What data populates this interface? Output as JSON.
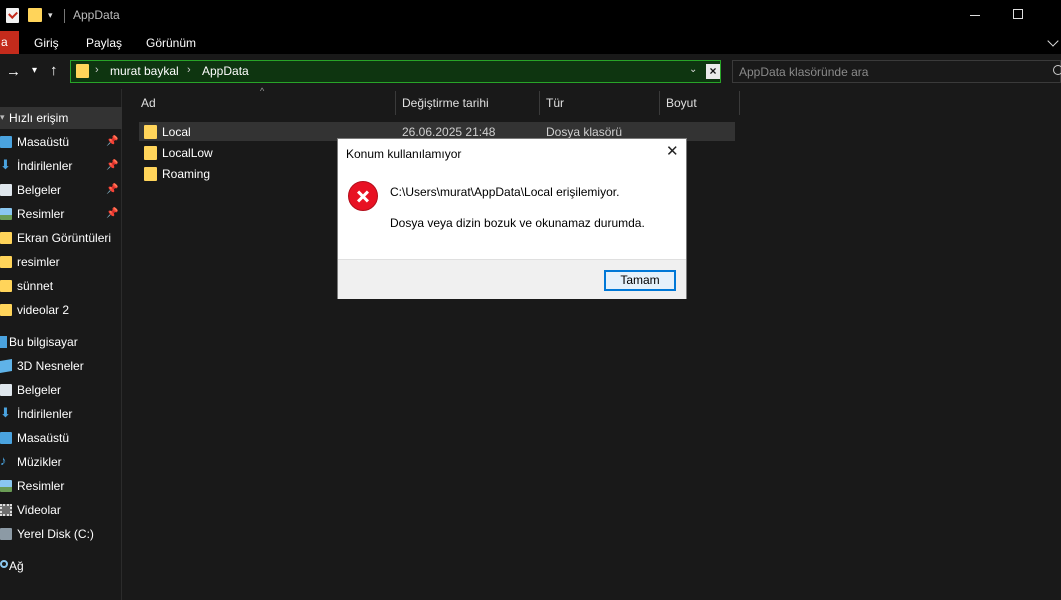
{
  "window": {
    "title": "AppData"
  },
  "ribbon": {
    "file_label": "a",
    "tabs": [
      "Giriş",
      "Paylaş",
      "Görünüm"
    ]
  },
  "address": {
    "crumbs": [
      "murat baykal",
      "AppData"
    ],
    "search_placeholder": "AppData klasöründe ara"
  },
  "sidebar": {
    "quick_access": {
      "label": "Hızlı erişim",
      "items": [
        {
          "label": "Masaüstü",
          "icon": "desktop-icon"
        },
        {
          "label": "İndirilenler",
          "icon": "download-icon"
        },
        {
          "label": "Belgeler",
          "icon": "documents-icon"
        },
        {
          "label": "Resimler",
          "icon": "pictures-icon"
        },
        {
          "label": "Ekran Görüntüleri",
          "icon": "folder-icon"
        },
        {
          "label": "resimler",
          "icon": "folder-icon"
        },
        {
          "label": "sünnet",
          "icon": "folder-icon"
        },
        {
          "label": "videolar 2",
          "icon": "folder-icon"
        }
      ]
    },
    "this_pc": {
      "label": "Bu bilgisayar",
      "items": [
        {
          "label": "3D Nesneler",
          "icon": "3d-objects-icon"
        },
        {
          "label": "Belgeler",
          "icon": "documents-icon"
        },
        {
          "label": "İndirilenler",
          "icon": "download-icon"
        },
        {
          "label": "Masaüstü",
          "icon": "desktop-icon"
        },
        {
          "label": "Müzikler",
          "icon": "music-icon"
        },
        {
          "label": "Resimler",
          "icon": "pictures-icon"
        },
        {
          "label": "Videolar",
          "icon": "videos-icon"
        },
        {
          "label": "Yerel Disk (C:)",
          "icon": "disk-icon"
        }
      ]
    },
    "network": {
      "label": "Ağ"
    }
  },
  "filelist": {
    "columns": {
      "name": "Ad",
      "date": "Değiştirme tarihi",
      "type": "Tür",
      "size": "Boyut"
    },
    "rows": [
      {
        "name": "Local",
        "date": "26.06.2025 21:48",
        "type": "Dosya klasörü"
      },
      {
        "name": "LocalLow",
        "date": "",
        "type": ""
      },
      {
        "name": "Roaming",
        "date": "",
        "type": ""
      }
    ]
  },
  "dialog": {
    "title": "Konum kullanılamıyor",
    "message_path": "C:\\Users\\murat\\AppData\\Local erişilemiyor.",
    "message_detail": "Dosya veya dizin bozuk ve okunamaz durumda.",
    "ok_label": "Tamam"
  },
  "colors": {
    "accent_file_tab": "#c42b1c",
    "address_bar_bg": "#0e3510",
    "address_bar_border": "#28a428",
    "error_red": "#e81123",
    "button_focus_border": "#0078d7"
  }
}
